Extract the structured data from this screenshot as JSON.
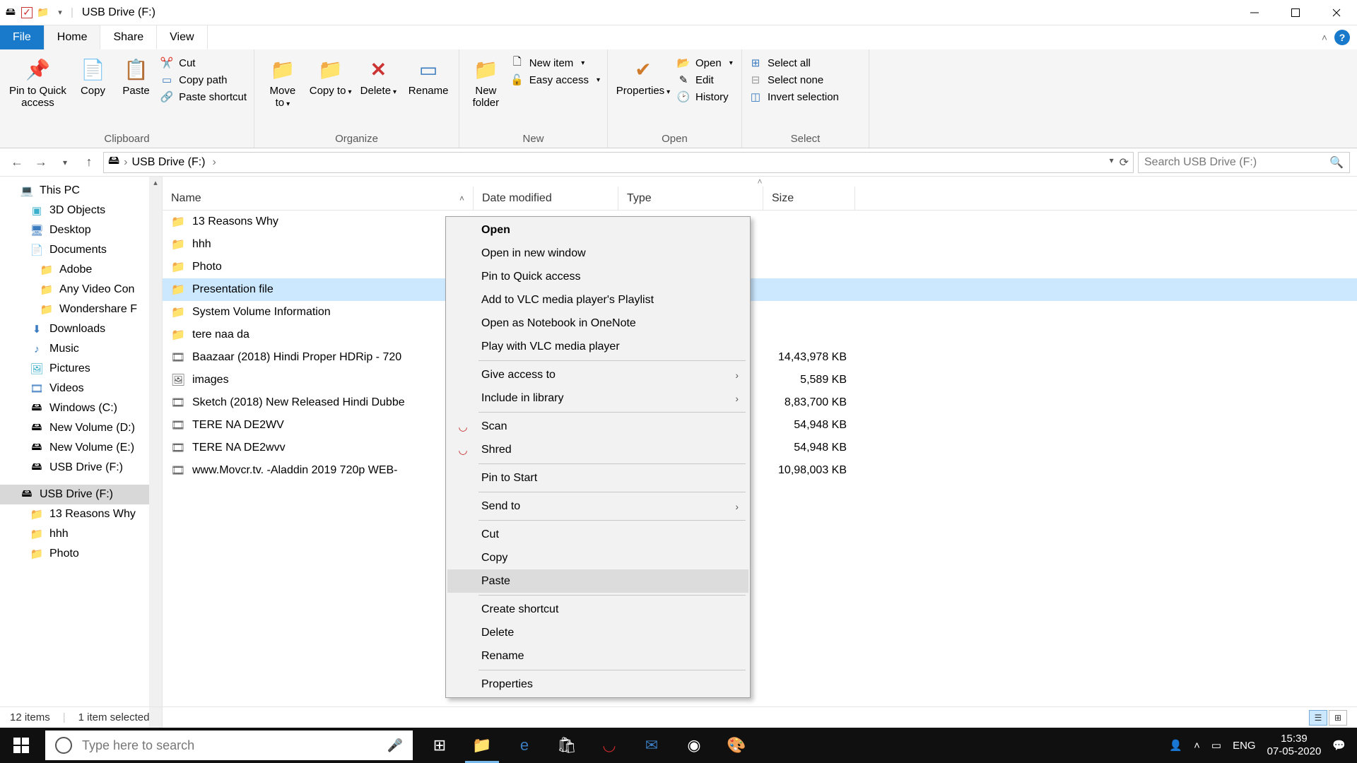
{
  "window": {
    "title": "USB Drive (F:)"
  },
  "tabs": {
    "file": "File",
    "home": "Home",
    "share": "Share",
    "view": "View"
  },
  "ribbon": {
    "clipboard": {
      "label": "Clipboard",
      "pin": "Pin to Quick access",
      "copy": "Copy",
      "paste": "Paste",
      "cut": "Cut",
      "copy_path": "Copy path",
      "paste_shortcut": "Paste shortcut"
    },
    "organize": {
      "label": "Organize",
      "move_to": "Move to",
      "copy_to": "Copy to",
      "delete": "Delete",
      "rename": "Rename"
    },
    "new": {
      "label": "New",
      "new_folder": "New folder",
      "new_item": "New item",
      "easy_access": "Easy access"
    },
    "open": {
      "label": "Open",
      "properties": "Properties",
      "open": "Open",
      "edit": "Edit",
      "history": "History"
    },
    "select": {
      "label": "Select",
      "select_all": "Select all",
      "select_none": "Select none",
      "invert": "Invert selection"
    }
  },
  "address": {
    "location": "USB Drive (F:)"
  },
  "search": {
    "placeholder": "Search USB Drive (F:)"
  },
  "columns": {
    "name": "Name",
    "date": "Date modified",
    "type": "Type",
    "size": "Size"
  },
  "sidebar": {
    "this_pc": "This PC",
    "objects3d": "3D Objects",
    "desktop": "Desktop",
    "documents": "Documents",
    "adobe": "Adobe",
    "anyvideo": "Any Video Con",
    "wondershare": "Wondershare F",
    "downloads": "Downloads",
    "music": "Music",
    "pictures": "Pictures",
    "videos": "Videos",
    "windows_c": "Windows (C:)",
    "volume_d": "New Volume (D:)",
    "volume_e": "New Volume (E:)",
    "usb_f": "USB Drive (F:)",
    "usb_f2": "USB Drive (F:)",
    "r13": "13 Reasons Why",
    "hhh": "hhh",
    "photo": "Photo"
  },
  "files": [
    {
      "name": "13 Reasons Why",
      "icon": "folder",
      "size": ""
    },
    {
      "name": "hhh",
      "icon": "folder",
      "size": ""
    },
    {
      "name": "Photo",
      "icon": "folder",
      "size": ""
    },
    {
      "name": "Presentation file",
      "icon": "folder",
      "size": "",
      "selected": true
    },
    {
      "name": "System Volume Information",
      "icon": "folder",
      "size": ""
    },
    {
      "name": "tere naa da",
      "icon": "folder",
      "size": ""
    },
    {
      "name": "Baazaar (2018) Hindi Proper HDRip - 720",
      "icon": "video",
      "size": "14,43,978 KB"
    },
    {
      "name": "images",
      "icon": "image",
      "size": "5,589 KB"
    },
    {
      "name": "Sketch (2018) New Released Hindi Dubbe",
      "icon": "video",
      "size": "8,83,700 KB"
    },
    {
      "name": "TERE NA DE2WV",
      "icon": "video",
      "size": "54,948 KB"
    },
    {
      "name": "TERE NA DE2wvv",
      "icon": "video",
      "size": "54,948 KB"
    },
    {
      "name": "www.Movcr.tv. -Aladdin 2019 720p WEB-",
      "icon": "video",
      "size": "10,98,003 KB"
    }
  ],
  "context_menu": {
    "open": "Open",
    "open_new": "Open in new window",
    "pin_quick": "Pin to Quick access",
    "vlc_playlist": "Add to VLC media player's Playlist",
    "onenote": "Open as Notebook in OneNote",
    "vlc_play": "Play with VLC media player",
    "give_access": "Give access to",
    "include_lib": "Include in library",
    "scan": "Scan",
    "shred": "Shred",
    "pin_start": "Pin to Start",
    "send_to": "Send to",
    "cut": "Cut",
    "copy": "Copy",
    "paste": "Paste",
    "create_shortcut": "Create shortcut",
    "delete": "Delete",
    "rename": "Rename",
    "properties": "Properties"
  },
  "status": {
    "items": "12 items",
    "selected": "1 item selected"
  },
  "taskbar": {
    "search_placeholder": "Type here to search",
    "lang": "ENG",
    "time": "15:39",
    "date": "07-05-2020"
  }
}
